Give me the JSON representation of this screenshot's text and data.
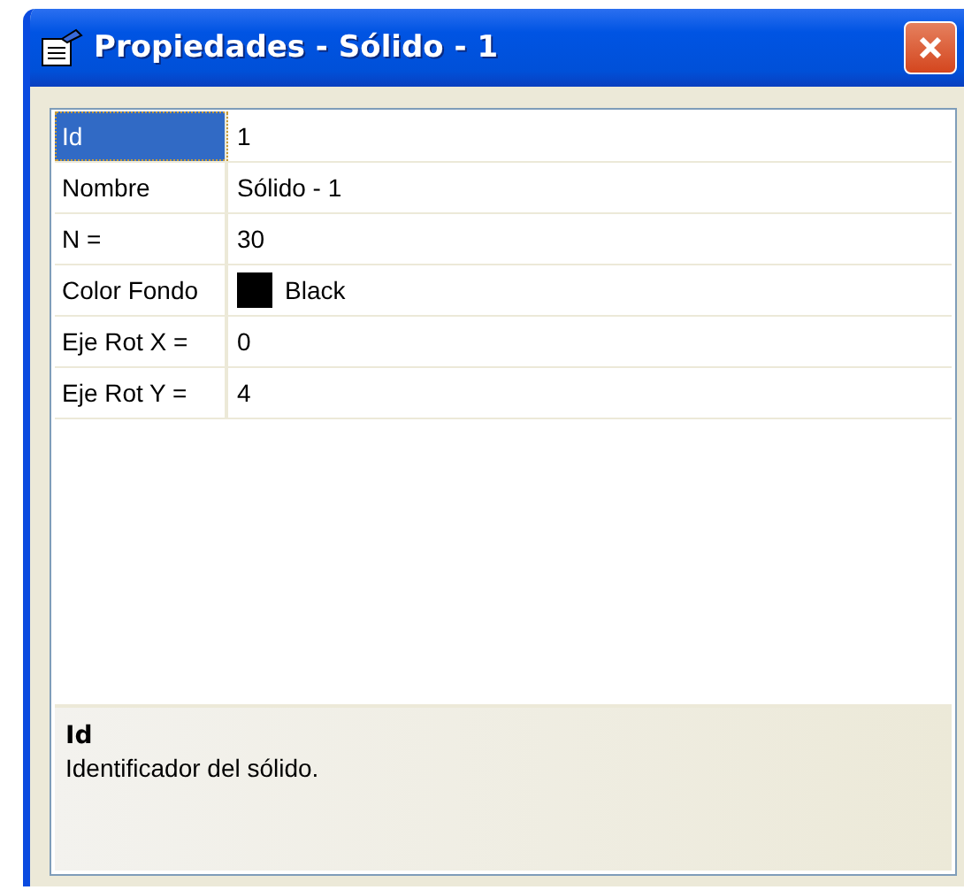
{
  "window": {
    "title": "Propiedades - Sólido - 1"
  },
  "properties": [
    {
      "name": "Id",
      "value": "1",
      "selected": true,
      "kind": "text"
    },
    {
      "name": "Nombre",
      "value": "Sólido - 1",
      "selected": false,
      "kind": "text"
    },
    {
      "name": "N =",
      "value": "30",
      "selected": false,
      "kind": "text"
    },
    {
      "name": "Color Fondo",
      "value": "Black",
      "selected": false,
      "kind": "color",
      "color": "#000000"
    },
    {
      "name": "Eje Rot X =",
      "value": "0",
      "selected": false,
      "kind": "text"
    },
    {
      "name": "Eje Rot Y =",
      "value": "4",
      "selected": false,
      "kind": "text"
    }
  ],
  "description": {
    "title": "Id",
    "text": "Identificador del sólido."
  }
}
